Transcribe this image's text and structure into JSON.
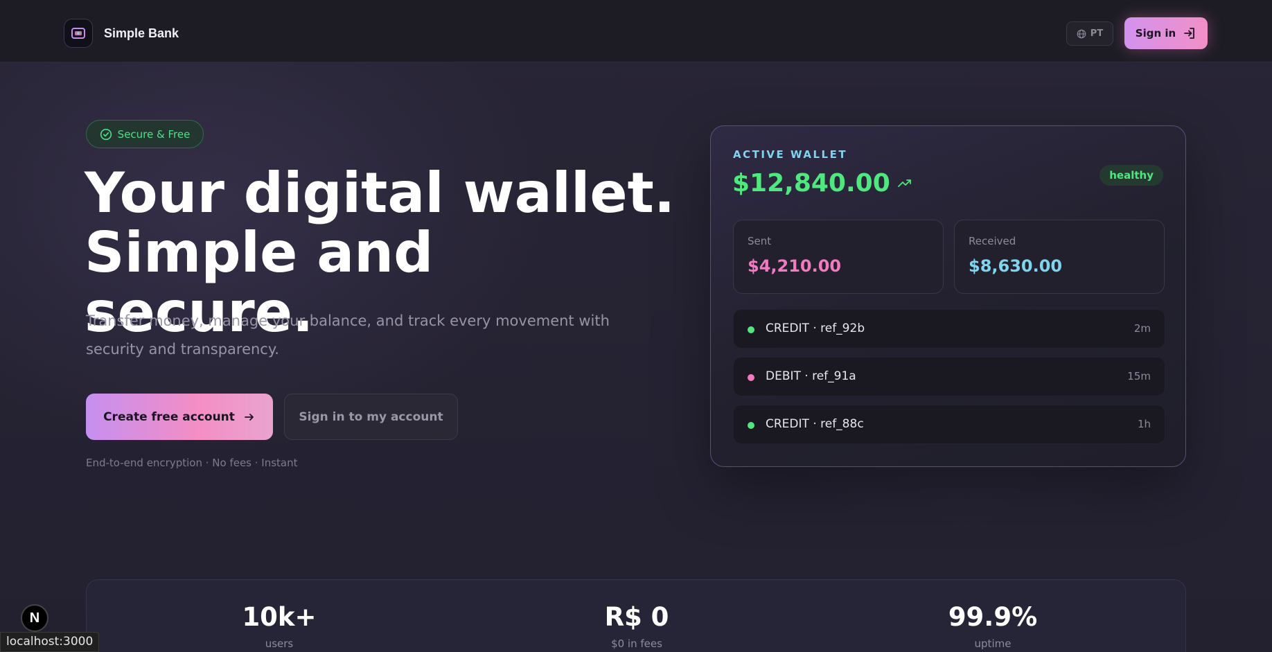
{
  "header": {
    "brand_name": "Simple Bank",
    "lang_label": "PT",
    "signin_label": "Sign in"
  },
  "hero": {
    "badge": "Secure & Free",
    "headline_line1": "Your digital wallet.",
    "headline_line2": "Simple and secure.",
    "subtitle": "Transfer money, manage your balance, and track every movement with security and transparency.",
    "cta_primary": "Create free account",
    "cta_secondary": "Sign in to my account",
    "features": "End-to-end encryption · No fees · Instant"
  },
  "wallet": {
    "label": "ACTIVE WALLET",
    "balance": "$12,840.00",
    "health": "healthy",
    "sent_label": "Sent",
    "sent_value": "$4,210.00",
    "received_label": "Received",
    "received_value": "$8,630.00",
    "transactions": [
      {
        "name": "CREDIT · ref_92b",
        "time": "2m",
        "color": "#4ee87e"
      },
      {
        "name": "DEBIT · ref_91a",
        "time": "15m",
        "color": "#f27ac1"
      },
      {
        "name": "CREDIT · ref_88c",
        "time": "1h",
        "color": "#4ee87e"
      }
    ]
  },
  "stats": [
    {
      "value": "10k+",
      "caption": "users"
    },
    {
      "value": "R$ 0",
      "caption": "$0 in fees"
    },
    {
      "value": "99.9%",
      "caption": "uptime"
    }
  ],
  "overlays": {
    "next_badge": "N",
    "status_url": "localhost:3000"
  },
  "colors": {
    "accent_pink": "#f28fc6",
    "accent_purple": "#c58ff0",
    "success": "#4ee87e",
    "info": "#7fd5ef",
    "debit": "#f27ac1"
  }
}
